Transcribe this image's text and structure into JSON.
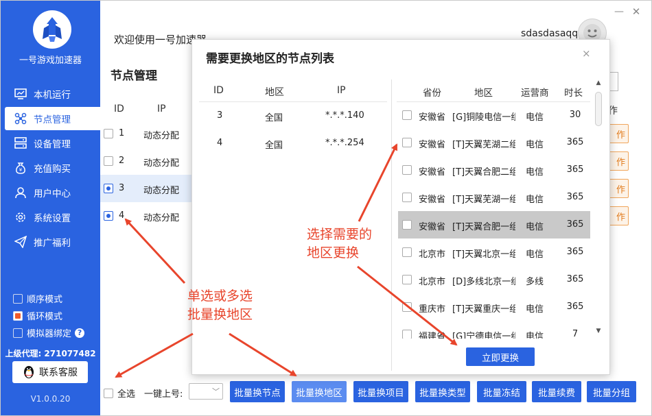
{
  "app": {
    "name": "一号游戏加速器",
    "version": "V1.0.0.20",
    "agent": "上级代理: 271077482",
    "service_label": "联系客服"
  },
  "header": {
    "welcome": "欢迎使用一号加速器",
    "username": "sdasdasaqq"
  },
  "sidebar": {
    "items": [
      {
        "label": "本机运行",
        "icon": "monitor-icon"
      },
      {
        "label": "节点管理",
        "icon": "node-network-icon"
      },
      {
        "label": "设备管理",
        "icon": "server-icon"
      },
      {
        "label": "充值购买",
        "icon": "yen-bag-icon"
      },
      {
        "label": "用户中心",
        "icon": "user-icon"
      },
      {
        "label": "系统设置",
        "icon": "gear-icon"
      },
      {
        "label": "推广福利",
        "icon": "paper-plane-icon"
      }
    ]
  },
  "modes": [
    {
      "label": "顺序模式",
      "checked": false
    },
    {
      "label": "循环模式",
      "checked": true
    },
    {
      "label": "模拟器绑定",
      "checked": false
    }
  ],
  "page": {
    "title": "节点管理",
    "columns": {
      "id": "ID",
      "ip": "IP",
      "op": "操作"
    },
    "rows": [
      {
        "id": "1",
        "ip": "动态分配",
        "selected": false,
        "op": "操作"
      },
      {
        "id": "2",
        "ip": "动态分配",
        "selected": false,
        "op": "操作"
      },
      {
        "id": "3",
        "ip": "动态分配",
        "selected": true,
        "op": "操作"
      },
      {
        "id": "4",
        "ip": "动态分配",
        "selected": true,
        "op": "操作"
      }
    ]
  },
  "bottom": {
    "select_all": "全选",
    "quick_label": "一键上号:",
    "buttons": [
      "批量换节点",
      "批量换地区",
      "批量换项目",
      "批量换类型",
      "批量冻结",
      "批量续费",
      "批量分组"
    ]
  },
  "dialog": {
    "title": "需要更换地区的节点列表",
    "close": "×",
    "left_headers": [
      "ID",
      "地区",
      "IP"
    ],
    "left_rows": [
      {
        "id": "3",
        "region": "全国",
        "ip": "*.*.*.140"
      },
      {
        "id": "4",
        "region": "全国",
        "ip": "*.*.*.254"
      }
    ],
    "right_headers": [
      "省份",
      "地区",
      "运营商",
      "时长"
    ],
    "right_rows": [
      {
        "province": "安徽省",
        "area": "[G]铜陵电信一组",
        "isp": "电信",
        "duration": "30"
      },
      {
        "province": "安徽省",
        "area": "[T]天翼芜湖二组",
        "isp": "电信",
        "duration": "365"
      },
      {
        "province": "安徽省",
        "area": "[T]天翼合肥二组",
        "isp": "电信",
        "duration": "365"
      },
      {
        "province": "安徽省",
        "area": "[T]天翼芜湖一组",
        "isp": "电信",
        "duration": "365"
      },
      {
        "province": "安徽省",
        "area": "[T]天翼合肥一组",
        "isp": "电信",
        "duration": "365"
      },
      {
        "province": "北京市",
        "area": "[T]天翼北京一组",
        "isp": "电信",
        "duration": "365"
      },
      {
        "province": "北京市",
        "area": "[D]多线北京一组",
        "isp": "多线",
        "duration": "365"
      },
      {
        "province": "重庆市",
        "area": "[T]天翼重庆一组",
        "isp": "电信",
        "duration": "365"
      },
      {
        "province": "福建省",
        "area": "[G]宁德电信一组",
        "isp": "电信",
        "duration": "7"
      }
    ],
    "apply_label": "立即更换"
  },
  "annotations": {
    "region_line1": "选择需要的",
    "region_line2": "地区更换",
    "select_line1": "单选或多选",
    "select_line2": "批量换地区"
  },
  "colors": {
    "brand": "#2a63e0",
    "annotation": "#e8452c",
    "op_button": "#f0a55a"
  }
}
